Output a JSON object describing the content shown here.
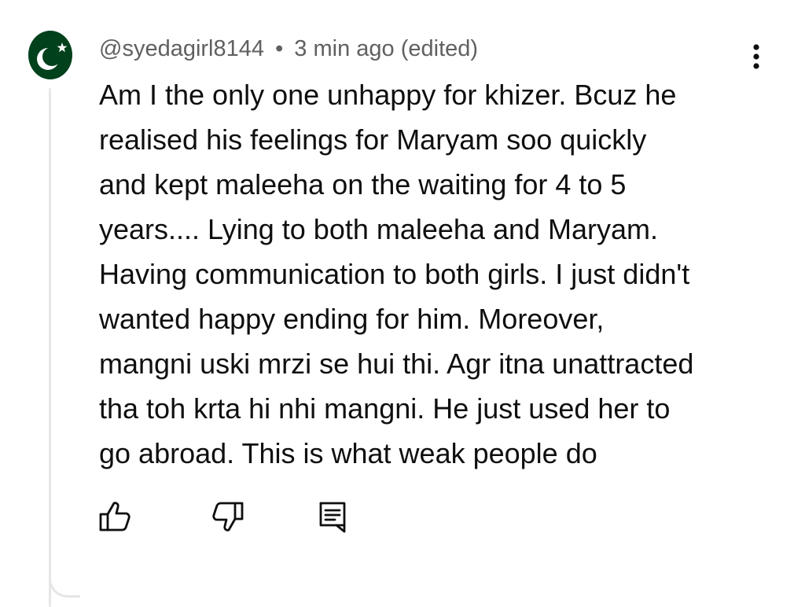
{
  "comment": {
    "author": "@syedagirl8144",
    "separator": "•",
    "time": "3 min ago",
    "edited": "(edited)",
    "lines": [
      "Am I the only one unhappy for khizer. Bcuz he",
      "realised his feelings for Maryam soo quickly",
      "and kept maleeha on the waiting for 4 to 5",
      "years.... Lying to both maleeha and Maryam.",
      "Having communication to both girls. I just didn't",
      "wanted happy ending for him. Moreover,",
      "mangni uski mrzi se hui thi. Agr itna unattracted",
      "tha toh krta hi nhi mangni. He just used her to",
      "go abroad. This is what weak people do"
    ]
  },
  "icons": {
    "avatar": "pakistan-flag-avatar",
    "menu": "more-vert-icon",
    "like": "thumbs-up-icon",
    "dislike": "thumbs-down-icon",
    "reply": "reply-comment-icon"
  },
  "colors": {
    "avatar_green": "#01411c",
    "meta_text": "#606060",
    "body_text": "#0f0f0f",
    "icon": "#0f0f0f",
    "thread_line": "#e6e6e6"
  }
}
